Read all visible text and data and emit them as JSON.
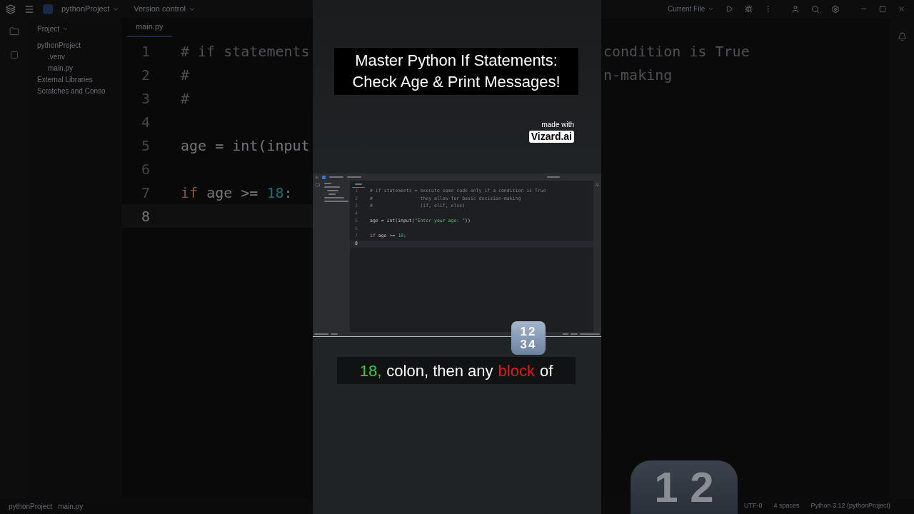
{
  "backdrop": {
    "top_bar": {
      "project": "pythonProject",
      "vcs": "Version control",
      "run_config": "Current File"
    },
    "project_header": "Project",
    "tree": [
      {
        "label": "pythonProject",
        "children": [
          {
            "label": ".venv"
          },
          {
            "label": "main.py"
          }
        ]
      },
      {
        "label": "External Libraries"
      },
      {
        "label": "Scratches and Conso"
      }
    ],
    "tab": "main.py",
    "code_left": [
      {
        "number": "1",
        "current": false,
        "tokens": [
          {
            "kind": "comment",
            "text": "# if statements"
          }
        ]
      },
      {
        "number": "2",
        "current": false,
        "tokens": [
          {
            "kind": "comment",
            "text": "#"
          }
        ]
      },
      {
        "number": "3",
        "current": false,
        "tokens": [
          {
            "kind": "comment",
            "text": "#"
          }
        ]
      },
      {
        "number": "4",
        "current": false
      },
      {
        "number": "5",
        "current": false,
        "tokens": [
          {
            "kind": "plain",
            "text": "age = int(input"
          }
        ]
      },
      {
        "number": "6",
        "current": false
      },
      {
        "number": "7",
        "current": false,
        "tokens": [
          {
            "kind": "keyword",
            "text": "if"
          },
          {
            "kind": "plain",
            "text": " age >= "
          },
          {
            "kind": "number",
            "text": "18"
          },
          {
            "kind": "plain",
            "text": ":"
          }
        ]
      },
      {
        "number": "8",
        "current": true
      }
    ],
    "code_right": [
      {
        "tokens": [
          {
            "kind": "comment",
            "text": "condition is True"
          }
        ]
      },
      {
        "tokens": [
          {
            "kind": "comment",
            "text": "n-making"
          }
        ]
      }
    ],
    "status_left": [
      "pythonProject",
      "main.py"
    ],
    "status_right": [
      "UTF-8",
      "4 spaces",
      "Python 3.12 (pythonProject)"
    ],
    "keycap": "1 2"
  },
  "title_lines": [
    "Master Python If Statements:",
    "Check Age & Print Messages!"
  ],
  "made_with": {
    "label": "made with",
    "brand": "Vizard.ai"
  },
  "ide": {
    "code": [
      {
        "number": "1",
        "current": false,
        "tokens": [
          {
            "kind": "comment",
            "text": "# if statements = execute some code only if a condition is True"
          }
        ]
      },
      {
        "number": "2",
        "current": false,
        "tokens": [
          {
            "kind": "comment",
            "text": "#                 they allow for basic decision-making"
          }
        ]
      },
      {
        "number": "3",
        "current": false,
        "tokens": [
          {
            "kind": "comment",
            "text": "#                 (if, elif, else)"
          }
        ]
      },
      {
        "number": "4",
        "current": false
      },
      {
        "number": "5",
        "current": false,
        "tokens": [
          {
            "kind": "plain",
            "text": "age = int(input("
          },
          {
            "kind": "string",
            "text": "\"Enter your age: \""
          },
          {
            "kind": "plain",
            "text": "))"
          }
        ]
      },
      {
        "number": "6",
        "current": false
      },
      {
        "number": "7",
        "current": false,
        "tokens": [
          {
            "kind": "keyword",
            "text": "if"
          },
          {
            "kind": "plain",
            "text": " age >= "
          },
          {
            "kind": "number",
            "text": "18"
          },
          {
            "kind": "plain",
            "text": ":"
          }
        ]
      },
      {
        "number": "8",
        "current": true
      }
    ]
  },
  "keycap_lines": [
    "12",
    "34"
  ],
  "caption": {
    "words": [
      {
        "text": "18,",
        "color": "#2ecc40"
      },
      {
        "text": "colon, then any",
        "color": "#ffffff"
      },
      {
        "text": "block",
        "color": "#e01b1b"
      },
      {
        "text": "of",
        "color": "#ffffff"
      }
    ]
  }
}
